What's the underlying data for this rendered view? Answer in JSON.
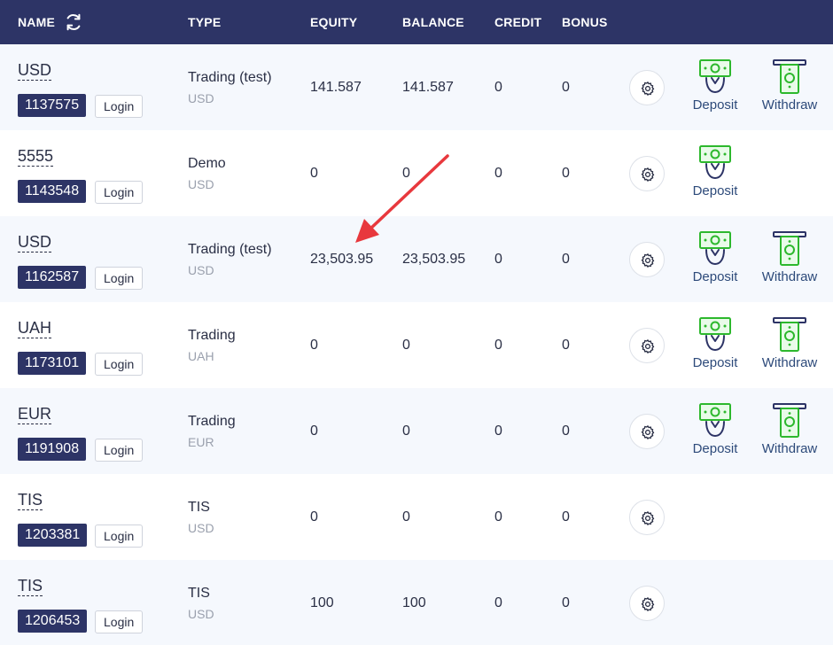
{
  "header": {
    "name": "NAME",
    "type": "TYPE",
    "equity": "EQUITY",
    "balance": "BALANCE",
    "credit": "CREDIT",
    "bonus": "BONUS"
  },
  "labels": {
    "login": "Login",
    "deposit": "Deposit",
    "withdraw": "Withdraw"
  },
  "colors": {
    "header_bg": "#2d3466",
    "accent_green": "#2db82d",
    "arrow_red": "#e8383d"
  },
  "rows": [
    {
      "currency": "USD",
      "account_id": "1137575",
      "type": "Trading (test)",
      "type_currency": "USD",
      "equity": "141.587",
      "balance": "141.587",
      "credit": "0",
      "bonus": "0"
    },
    {
      "currency": "5555",
      "account_id": "1143548",
      "type": "Demo",
      "type_currency": "USD",
      "equity": "0",
      "balance": "0",
      "credit": "0",
      "bonus": "0"
    },
    {
      "currency": "USD",
      "account_id": "1162587",
      "type": "Trading (test)",
      "type_currency": "USD",
      "equity": "23,503.95",
      "balance": "23,503.95",
      "credit": "0",
      "bonus": "0"
    },
    {
      "currency": "UAH",
      "account_id": "1173101",
      "type": "Trading",
      "type_currency": "UAH",
      "equity": "0",
      "balance": "0",
      "credit": "0",
      "bonus": "0"
    },
    {
      "currency": "EUR",
      "account_id": "1191908",
      "type": "Trading",
      "type_currency": "EUR",
      "equity": "0",
      "balance": "0",
      "credit": "0",
      "bonus": "0"
    },
    {
      "currency": "TIS",
      "account_id": "1203381",
      "type": "TIS",
      "type_currency": "USD",
      "equity": "0",
      "balance": "0",
      "credit": "0",
      "bonus": "0"
    },
    {
      "currency": "TIS",
      "account_id": "1206453",
      "type": "TIS",
      "type_currency": "USD",
      "equity": "100",
      "balance": "100",
      "credit": "0",
      "bonus": "0"
    }
  ]
}
